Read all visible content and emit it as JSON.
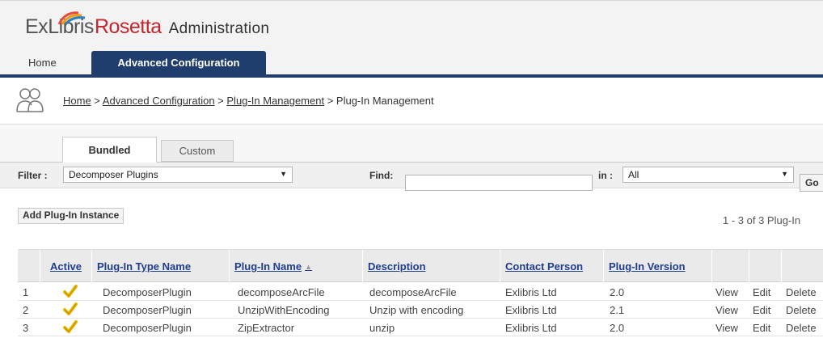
{
  "header": {
    "logo_ex": "Ex",
    "logo_libris": "Libris",
    "logo_product": "Rosetta",
    "logo_admin": "Administration"
  },
  "nav": {
    "home": "Home",
    "advanced": "Advanced Configuration"
  },
  "breadcrumb": {
    "items": [
      "Home",
      "Advanced Configuration",
      "Plug-In Management"
    ],
    "current": "Plug-In Management",
    "separator": " > "
  },
  "subtabs": {
    "bundled": "Bundled",
    "custom": "Custom"
  },
  "filter": {
    "label": "Filter :",
    "value": "Decomposer Plugins",
    "find_label": "Find:",
    "find_value": "",
    "in_label": "in :",
    "in_value": "All",
    "go": "Go"
  },
  "actions": {
    "add": "Add Plug-In Instance",
    "count": "1 - 3 of 3 Plug-In"
  },
  "table": {
    "columns": [
      "Active",
      "Plug-In Type Name",
      "Plug-In Name",
      "Description",
      "Contact Person",
      "Plug-In Version"
    ],
    "rows": [
      {
        "num": "1",
        "type": "DecomposerPlugin",
        "name": "decomposeArcFile",
        "desc": "decomposeArcFile",
        "contact": "Exlibris Ltd",
        "version": "2.0"
      },
      {
        "num": "2",
        "type": "DecomposerPlugin",
        "name": "UnzipWithEncoding",
        "desc": "Unzip with encoding",
        "contact": "Exlibris Ltd",
        "version": "2.1"
      },
      {
        "num": "3",
        "type": "DecomposerPlugin",
        "name": "ZipExtractor",
        "desc": "unzip",
        "contact": "Exlibris Ltd",
        "version": "2.0"
      }
    ],
    "row_actions": {
      "view": "View",
      "edit": "Edit",
      "delete": "Delete"
    }
  },
  "colors": {
    "nav": "#1f3d6d",
    "link": "#1f3d8f",
    "brand_red": "#c8242b"
  }
}
